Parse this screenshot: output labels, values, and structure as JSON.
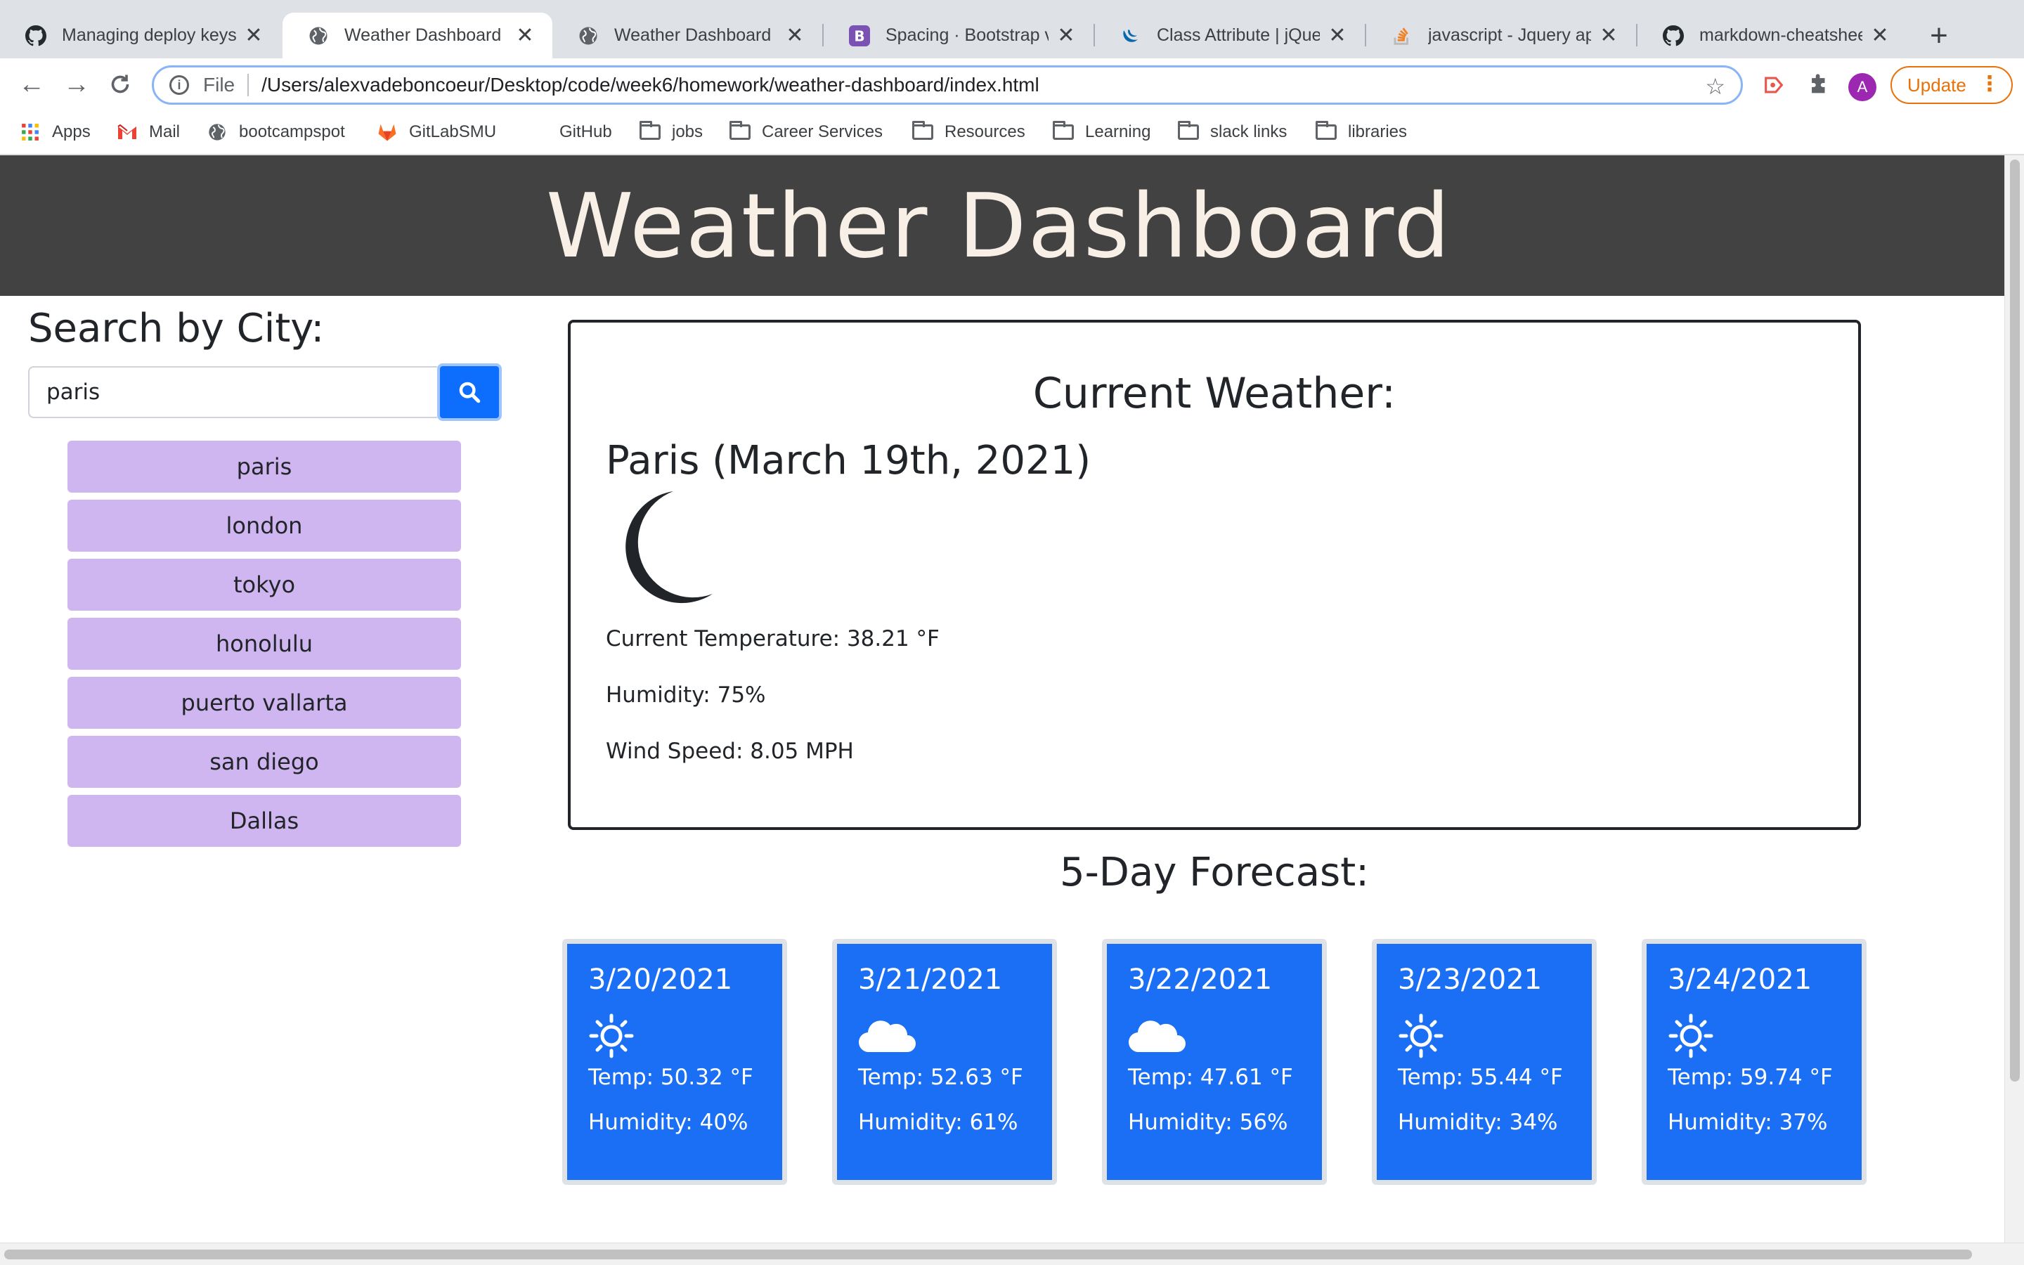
{
  "browser": {
    "tabs": [
      {
        "title": "Managing deploy keys",
        "icon": "github-icon"
      },
      {
        "title": "Weather Dashboard",
        "icon": "globe-icon",
        "active": true
      },
      {
        "title": "Weather Dashboard",
        "icon": "globe-icon"
      },
      {
        "title": "Spacing · Bootstrap v5",
        "icon": "bootstrap-icon"
      },
      {
        "title": "Class Attribute | jQuery",
        "icon": "jquery-icon"
      },
      {
        "title": "javascript - Jquery app",
        "icon": "stackoverflow-icon"
      },
      {
        "title": "markdown-cheatsheet",
        "icon": "github-icon"
      }
    ],
    "omnibox": {
      "scheme_label": "File",
      "url": "/Users/alexvadeboncoeur/Desktop/code/week6/homework/weather-dashboard/index.html"
    },
    "profile_initial": "A",
    "update_label": "Update",
    "bookmarks": [
      {
        "label": "Apps",
        "icon": "apps-grid-icon"
      },
      {
        "label": "Mail",
        "icon": "gmail-icon"
      },
      {
        "label": "bootcampspot",
        "icon": "globe-icon"
      },
      {
        "label": "GitLabSMU",
        "icon": "gitlab-icon"
      },
      {
        "label": "GitHub",
        "icon": "none"
      },
      {
        "label": "jobs",
        "icon": "folder-icon"
      },
      {
        "label": "Career Services",
        "icon": "folder-icon"
      },
      {
        "label": "Resources",
        "icon": "folder-icon"
      },
      {
        "label": "Learning",
        "icon": "folder-icon"
      },
      {
        "label": "slack links",
        "icon": "folder-icon"
      },
      {
        "label": "libraries",
        "icon": "folder-icon"
      }
    ]
  },
  "page": {
    "title": "Weather Dashboard",
    "header_bg": "#424242",
    "search": {
      "title": "Search by City:",
      "value": "paris",
      "button_icon": "search-icon",
      "button_color": "#0d6efd"
    },
    "history_color": "#cfb6f0",
    "history": [
      "paris",
      "london",
      "tokyo",
      "honolulu",
      "puerto vallarta",
      "san diego",
      "Dallas"
    ],
    "current": {
      "heading": "Current Weather:",
      "city_date": "Paris (March 19th, 2021)",
      "icon": "moon-icon",
      "temperature": "Current Temperature: 38.21 °F",
      "humidity": "Humidity: 75%",
      "wind": "Wind Speed: 8.05 MPH"
    },
    "forecast": {
      "heading": "5-Day Forecast:",
      "card_color": "#1a6ff5",
      "days": [
        {
          "date": "3/20/2021",
          "icon": "sun-icon",
          "temp": "Temp: 50.32 °F",
          "humidity": "Humidity: 40%"
        },
        {
          "date": "3/21/2021",
          "icon": "cloud-icon",
          "temp": "Temp: 52.63 °F",
          "humidity": "Humidity: 61%"
        },
        {
          "date": "3/22/2021",
          "icon": "cloud-icon",
          "temp": "Temp: 47.61 °F",
          "humidity": "Humidity: 56%"
        },
        {
          "date": "3/23/2021",
          "icon": "sun-icon",
          "temp": "Temp: 55.44 °F",
          "humidity": "Humidity: 34%"
        },
        {
          "date": "3/24/2021",
          "icon": "sun-icon",
          "temp": "Temp: 59.74 °F",
          "humidity": "Humidity: 37%"
        }
      ]
    }
  }
}
